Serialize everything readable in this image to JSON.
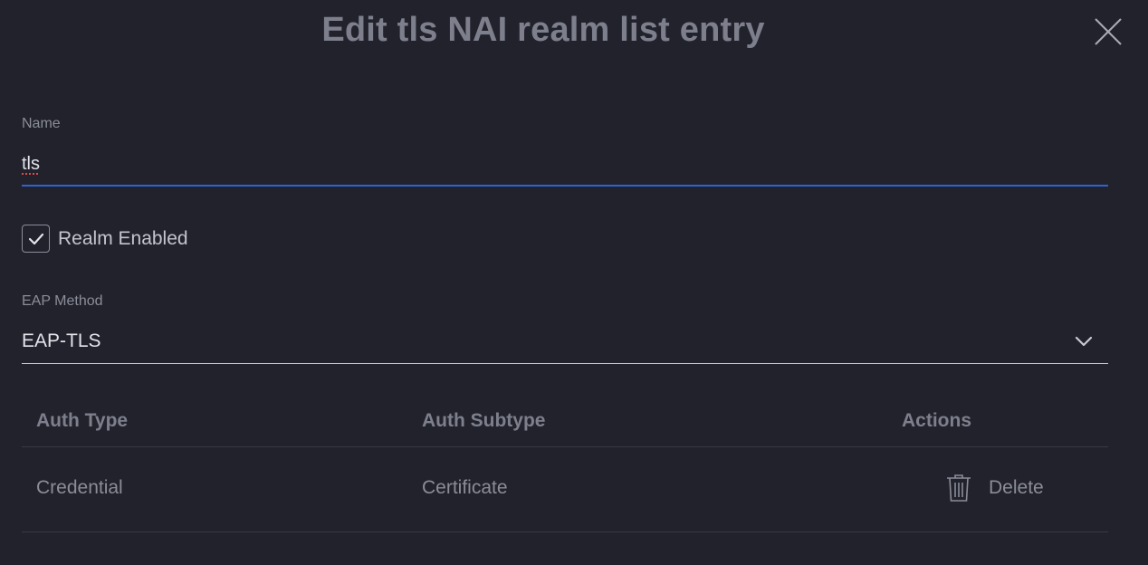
{
  "dialog": {
    "title": "Edit tls NAI realm list entry",
    "close_icon": "close-icon"
  },
  "form": {
    "name_label": "Name",
    "name_value": "tls",
    "realm_enabled_label": "Realm Enabled",
    "realm_enabled_checked": true,
    "eap_method_label": "EAP Method",
    "eap_method_value": "EAP-TLS"
  },
  "table": {
    "headers": [
      "Auth Type",
      "Auth Subtype",
      "Actions"
    ],
    "rows": [
      {
        "auth_type": "Credential",
        "auth_subtype": "Certificate",
        "action_label": "Delete"
      }
    ]
  },
  "colors": {
    "background": "#22222c",
    "accent": "#2e63d6",
    "muted_text": "#8a8d98"
  }
}
